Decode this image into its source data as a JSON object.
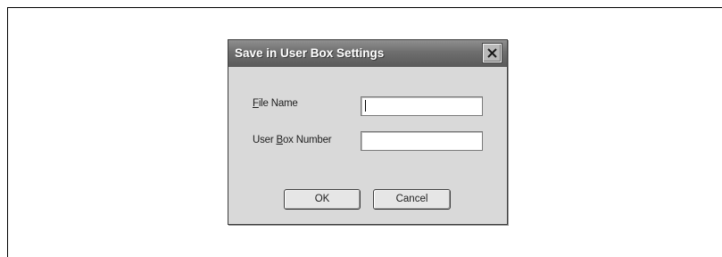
{
  "dialog": {
    "title": "Save in User Box Settings",
    "close_icon": "close-x-icon",
    "file_name": {
      "mnemonic": "F",
      "rest": "ile Name",
      "value": ""
    },
    "user_box_number": {
      "before": "User ",
      "mnemonic": "B",
      "after": "ox Number",
      "value": ""
    },
    "ok_label": "OK",
    "cancel_label": "Cancel"
  }
}
